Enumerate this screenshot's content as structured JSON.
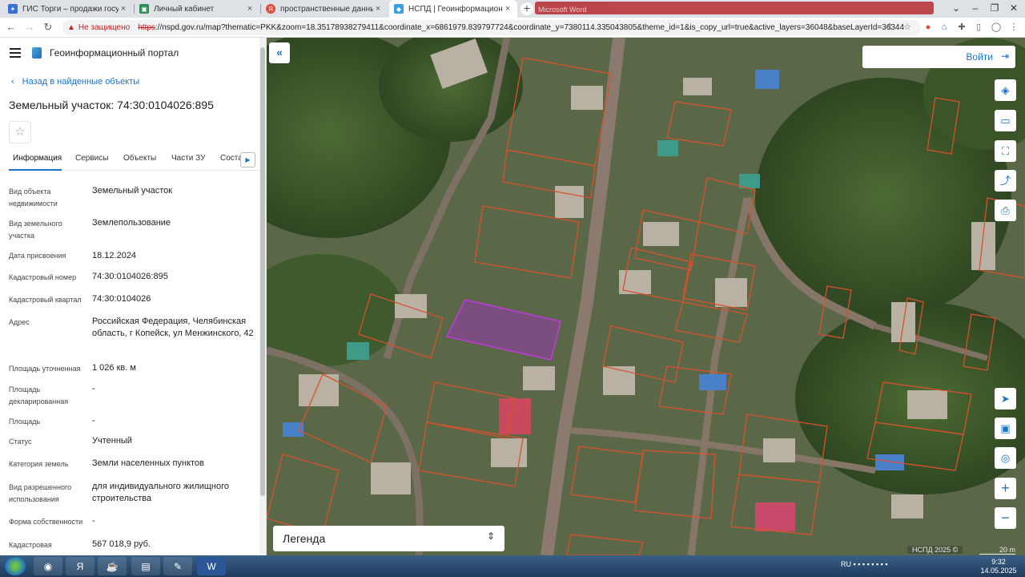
{
  "browser": {
    "tabs": [
      {
        "title": "ГИС Торги – продажи государст",
        "fav_color": "#3b6fd8",
        "active": false
      },
      {
        "title": "Личный кабинет",
        "fav_color": "#2e8b57",
        "active": false
      },
      {
        "title": "пространственные данные рос",
        "fav_color": "#e04b3a",
        "active": false
      },
      {
        "title": "НСПД | Геоинформационный п",
        "fav_color": "#3aa0e0",
        "active": true
      }
    ],
    "new_tab": "+",
    "hidden_tab_text": "Microsoft Word",
    "security_label": "Не защищено",
    "url_scheme": "https",
    "url_rest": "://nspd.gov.ru/map?thematic=PKK&zoom=18.35178938279411&coordinate_x=6861979.839797724&coordinate_y=7380114.335043805&theme_id=1&is_copy_url=true&active_layers=36048&baseLayerId=36344"
  },
  "panel": {
    "portal_name": "Геоинформационный портал",
    "back_label": "Назад в найденные объекты",
    "title": "Земельный участок: 74:30:0104026:895",
    "tabs": [
      "Информация",
      "Сервисы",
      "Объекты",
      "Части ЗУ",
      "Соста"
    ],
    "properties": [
      {
        "label": "Вид объекта недвижимости",
        "value": "Земельный участок"
      },
      {
        "label": "Вид земельного участка",
        "value": "Землепользование"
      },
      {
        "label": "Дата присвоения",
        "value": "18.12.2024"
      },
      {
        "label": "Кадастровый номер",
        "value": "74:30:0104026:895"
      },
      {
        "label": "Кадастровый квартал",
        "value": "74:30:0104026"
      },
      {
        "label": "Адрес",
        "value": "Российская Федерация, Челябинская область, г Копейск, ул Менжинского, 42"
      },
      {
        "label": "Площадь уточненная",
        "value": "1 026 кв. м"
      },
      {
        "label": "Площадь декларированная",
        "value": "-"
      },
      {
        "label": "Площадь",
        "value": "-"
      },
      {
        "label": "Статус",
        "value": "Учтенный"
      },
      {
        "label": "Категория земель",
        "value": "Земли населенных пунктов"
      },
      {
        "label": "Вид разрешенного использования",
        "value": "для индивидуального жилищного строительства"
      },
      {
        "label": "Форма собственности",
        "value": "-"
      },
      {
        "label": "Кадастровая",
        "value": "567 018,9 руб."
      }
    ]
  },
  "map": {
    "login_label": "Войти",
    "legend_label": "Легенда",
    "copyright": "НСПД 2025 ©",
    "scale_label": "20 m",
    "parcel_color": "#d9512c",
    "selected_color": "#a52fc4"
  },
  "taskbar": {
    "lang": "RU",
    "time": "9:32",
    "date": "14.05.2025"
  }
}
